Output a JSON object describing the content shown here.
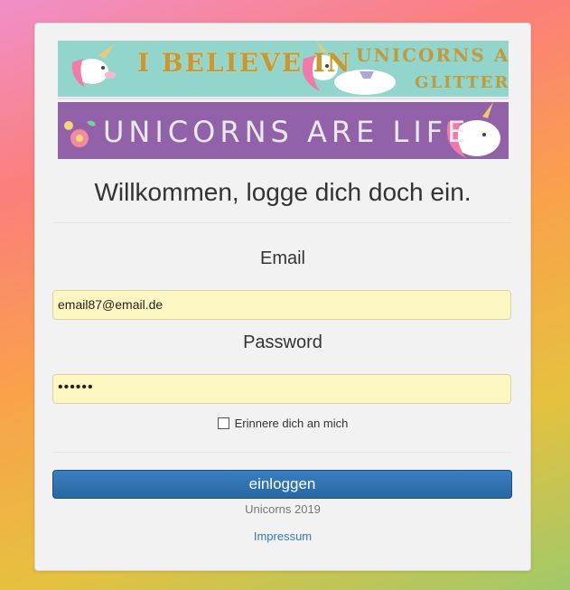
{
  "banner": {
    "top_line_1": "I BELIEVE IN",
    "top_line_2": "UNICORNS AND",
    "top_line_3": "GLITTER",
    "bottom_line": "UNICORNS ARE LIFE"
  },
  "login": {
    "title": "Willkommen, logge dich doch ein.",
    "email_label": "Email",
    "email_value": "email87@email.de",
    "password_label": "Password",
    "password_value": "••••••",
    "remember_label": "Erinnere dich an mich",
    "remember_checked": false,
    "submit_label": "einloggen"
  },
  "footer": {
    "copyright": "Unicorns 2019",
    "impressum_link": "Impressum"
  },
  "colors": {
    "button": "#2a66a3",
    "input_autofill": "#fdf7c2",
    "link": "#337ab7",
    "banner_top": "#92d5cc",
    "banner_bottom": "#9162a8"
  }
}
